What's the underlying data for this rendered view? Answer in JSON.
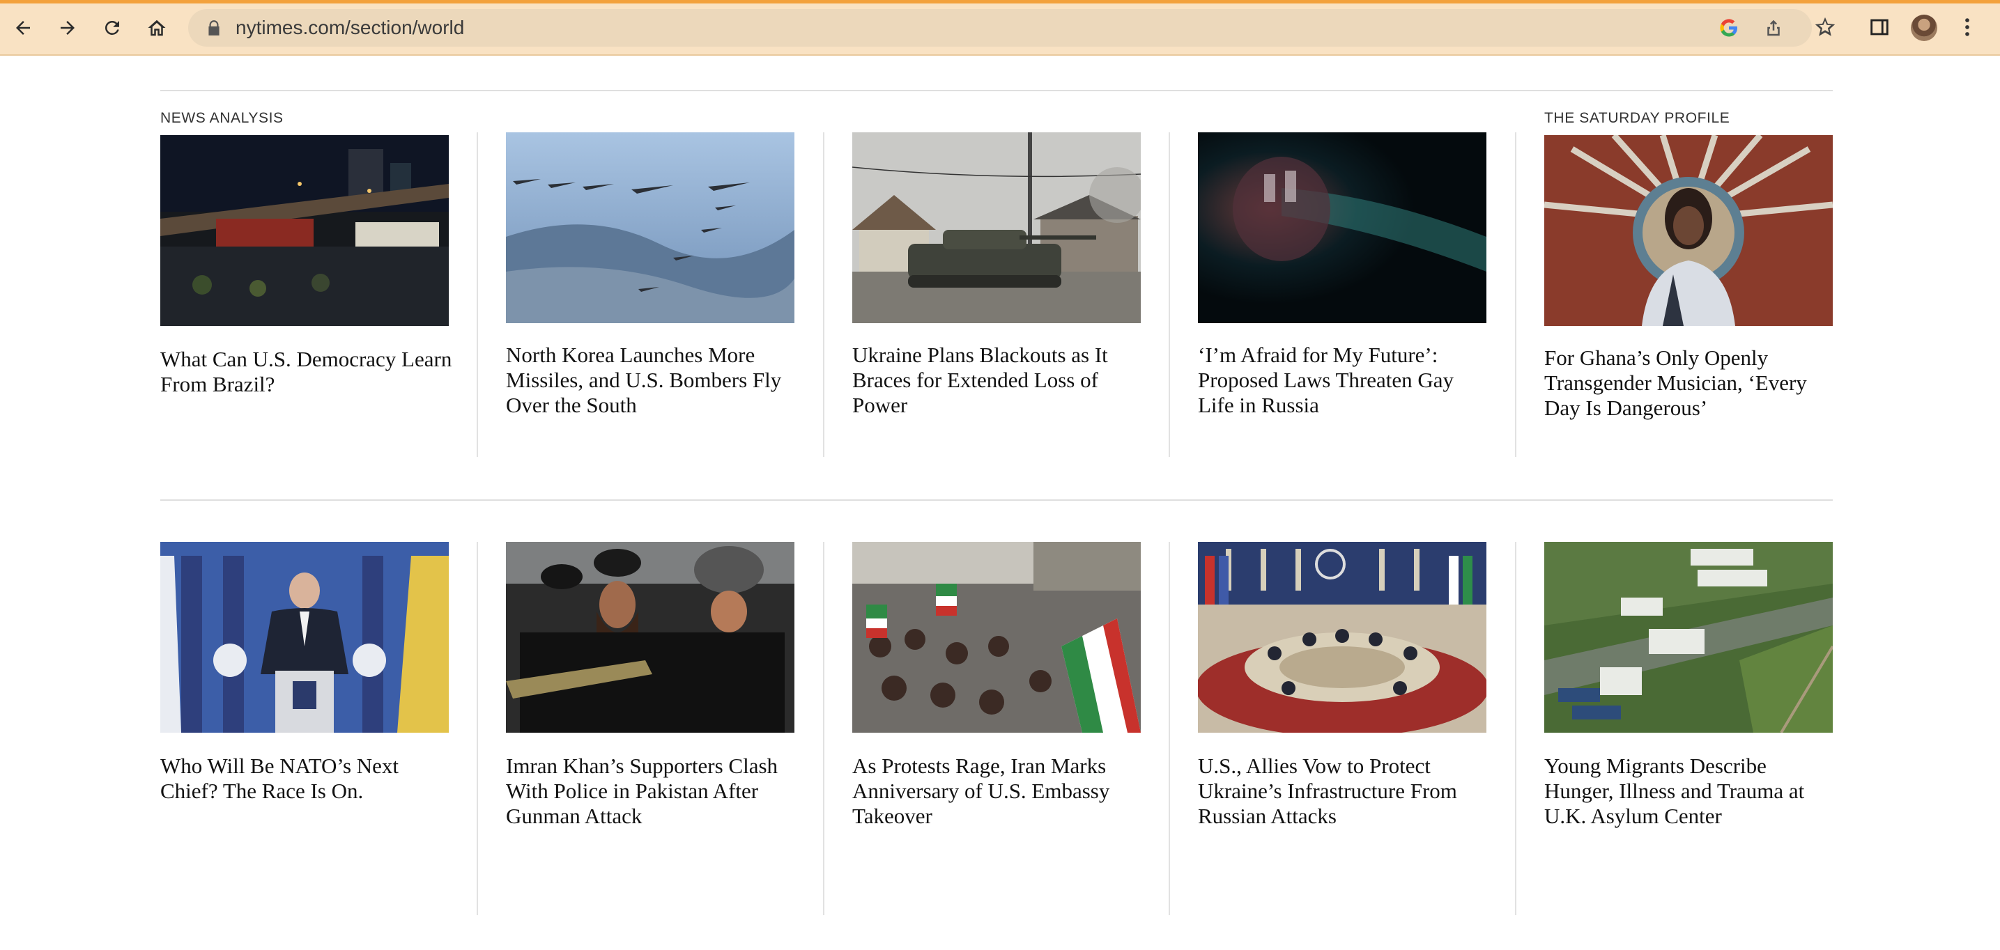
{
  "browser": {
    "url": "nytimes.com/section/world",
    "icons": [
      "back-arrow-icon",
      "forward-arrow-icon",
      "reload-icon",
      "home-icon",
      "lock-icon",
      "google-icon",
      "share-icon",
      "bookmark-star-icon",
      "side-panel-icon",
      "profile-avatar",
      "more-menu-icon"
    ]
  },
  "rows": [
    {
      "stories": [
        {
          "kicker": "NEWS ANALYSIS",
          "headline": "What Can U.S. Democracy Learn From Brazil?",
          "image": "night highway overpass with trucks"
        },
        {
          "kicker": "",
          "headline": "North Korea Launches More Missiles, and U.S. Bombers Fly Over the South",
          "image": "military jets flying in formation over land"
        },
        {
          "kicker": "",
          "headline": "Ukraine Plans Blackouts as It Braces for Extended Loss of Power",
          "image": "tank on a village road"
        },
        {
          "kicker": "",
          "headline": "‘I’m Afraid for My Future’: Proposed Laws Threaten Gay Life in Russia",
          "image": "dark teal lit stage scene"
        },
        {
          "kicker": "THE SATURDAY PROFILE",
          "headline": "For Ghana’s Only Openly Transgender Musician, ‘Every Day Is Dangerous’",
          "image": "portrait in front of sunburst mural"
        }
      ]
    },
    {
      "stories": [
        {
          "kicker": "",
          "headline": "Who Will Be NATO’s Next Chief? The Race Is On.",
          "image": "speaker at NATO podium with flags"
        },
        {
          "kicker": "",
          "headline": "Imran Khan’s Supporters Clash With Police in Pakistan After Gunman Attack",
          "image": "police in riot helmets with batons"
        },
        {
          "kicker": "",
          "headline": "As Protests Rage, Iran Marks Anniversary of U.S. Embassy Takeover",
          "image": "crowd waving Iranian flags"
        },
        {
          "kicker": "",
          "headline": "U.S., Allies Vow to Protect Ukraine’s Infrastructure From Russian Attacks",
          "image": "G7 round table meeting with flags"
        },
        {
          "kicker": "",
          "headline": "Young Migrants Describe Hunger, Illness and Trauma at U.K. Asylum Center",
          "image": "aerial view of asylum center tents"
        }
      ]
    }
  ],
  "colors": {
    "chrome_bg": "#f9e2c3",
    "omnibox_bg": "#ecd8bb",
    "loading_bar": "#f3a13c",
    "headline_text": "#121212",
    "divider": "#dfdfdf"
  }
}
